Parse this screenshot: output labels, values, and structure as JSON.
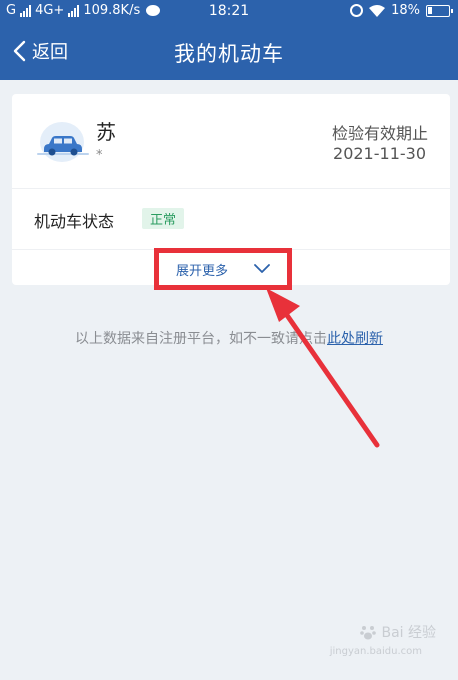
{
  "status_bar": {
    "carrier": "G",
    "network": "4G+",
    "speed": "109.8K/s",
    "time": "18:21",
    "battery": "18%"
  },
  "app_bar": {
    "back_label": "返回",
    "title": "我的机动车"
  },
  "vehicle": {
    "plate": "苏",
    "plate_sub": "*",
    "inspection_label": "检验有效期止",
    "inspection_date": "2021-11-30"
  },
  "status": {
    "label": "机动车状态",
    "value": "正常"
  },
  "expand": {
    "label": "展开更多"
  },
  "note": {
    "text": "以上数据来自注册平台，如不一致请点击",
    "link": "此处刷新"
  },
  "watermark": {
    "brand": "Bai 经验",
    "url": "jingyan.baidu.com"
  },
  "colors": {
    "app_bar": "#2c62ac",
    "background": "#edf1f5",
    "status_ok": "#2a9c60",
    "highlight": "#e8313a"
  }
}
